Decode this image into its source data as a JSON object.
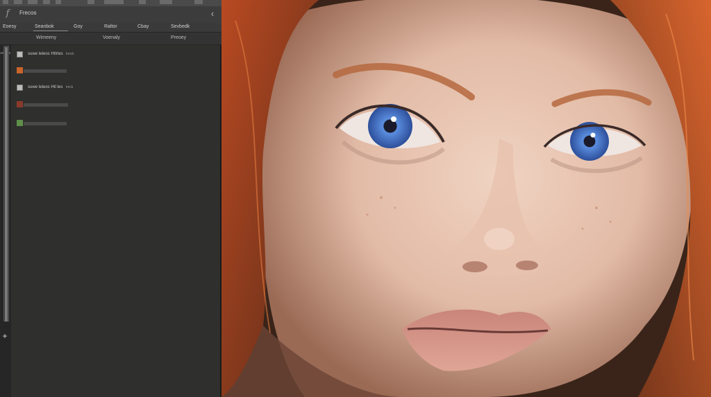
{
  "header": {
    "title": "Frecos",
    "fn_icon": "function-icon",
    "collapse_icon": "chevron-left-icon"
  },
  "tabs_row1": [
    "Eoesy",
    "Seanbok",
    "Goy",
    "Raltor",
    "Cbay",
    "Sevbedk"
  ],
  "tabs_row2": [
    "Wimeeny",
    "Voenaly",
    "Preoey"
  ],
  "gutter_label": "uneate",
  "layers": [
    {
      "name": "suwe teleos Htlrtes",
      "tag": "kmck",
      "thumb": "doc"
    },
    {
      "name": "",
      "thumb": "orange"
    },
    {
      "name": "suwe teleos Htl tes",
      "tag": "imck",
      "thumb": "doc"
    },
    {
      "name": "",
      "thumb": "red"
    },
    {
      "name": "",
      "thumb": "green"
    }
  ],
  "photo": {
    "description_icon": "portrait-image",
    "palette": {
      "hair": "#c7562a",
      "skin": "#e8c7b4",
      "iris": "#4f7fd0",
      "lips": "#d79686",
      "bg": "#3a2419"
    }
  }
}
